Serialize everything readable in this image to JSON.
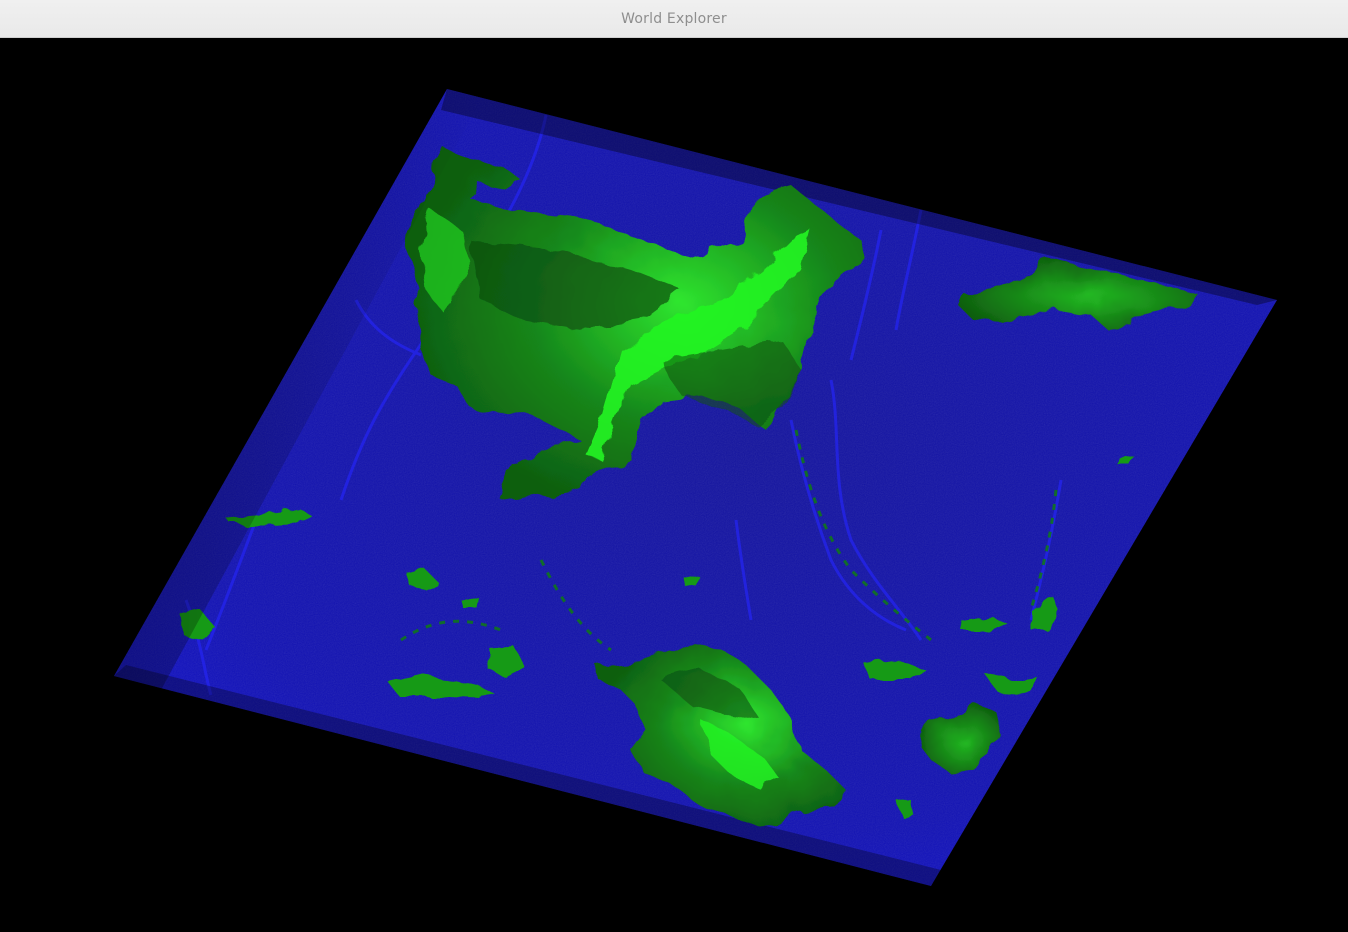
{
  "window": {
    "title": "World Explorer"
  },
  "colors": {
    "ocean": "#1414c8",
    "ocean_deep": "#0a0a7a",
    "land_low": "#0e5a0e",
    "land_high": "#19f019",
    "background": "#000000",
    "titlebar": "#ededed"
  },
  "view": {
    "mode": "3d-terrain-heightmap"
  }
}
